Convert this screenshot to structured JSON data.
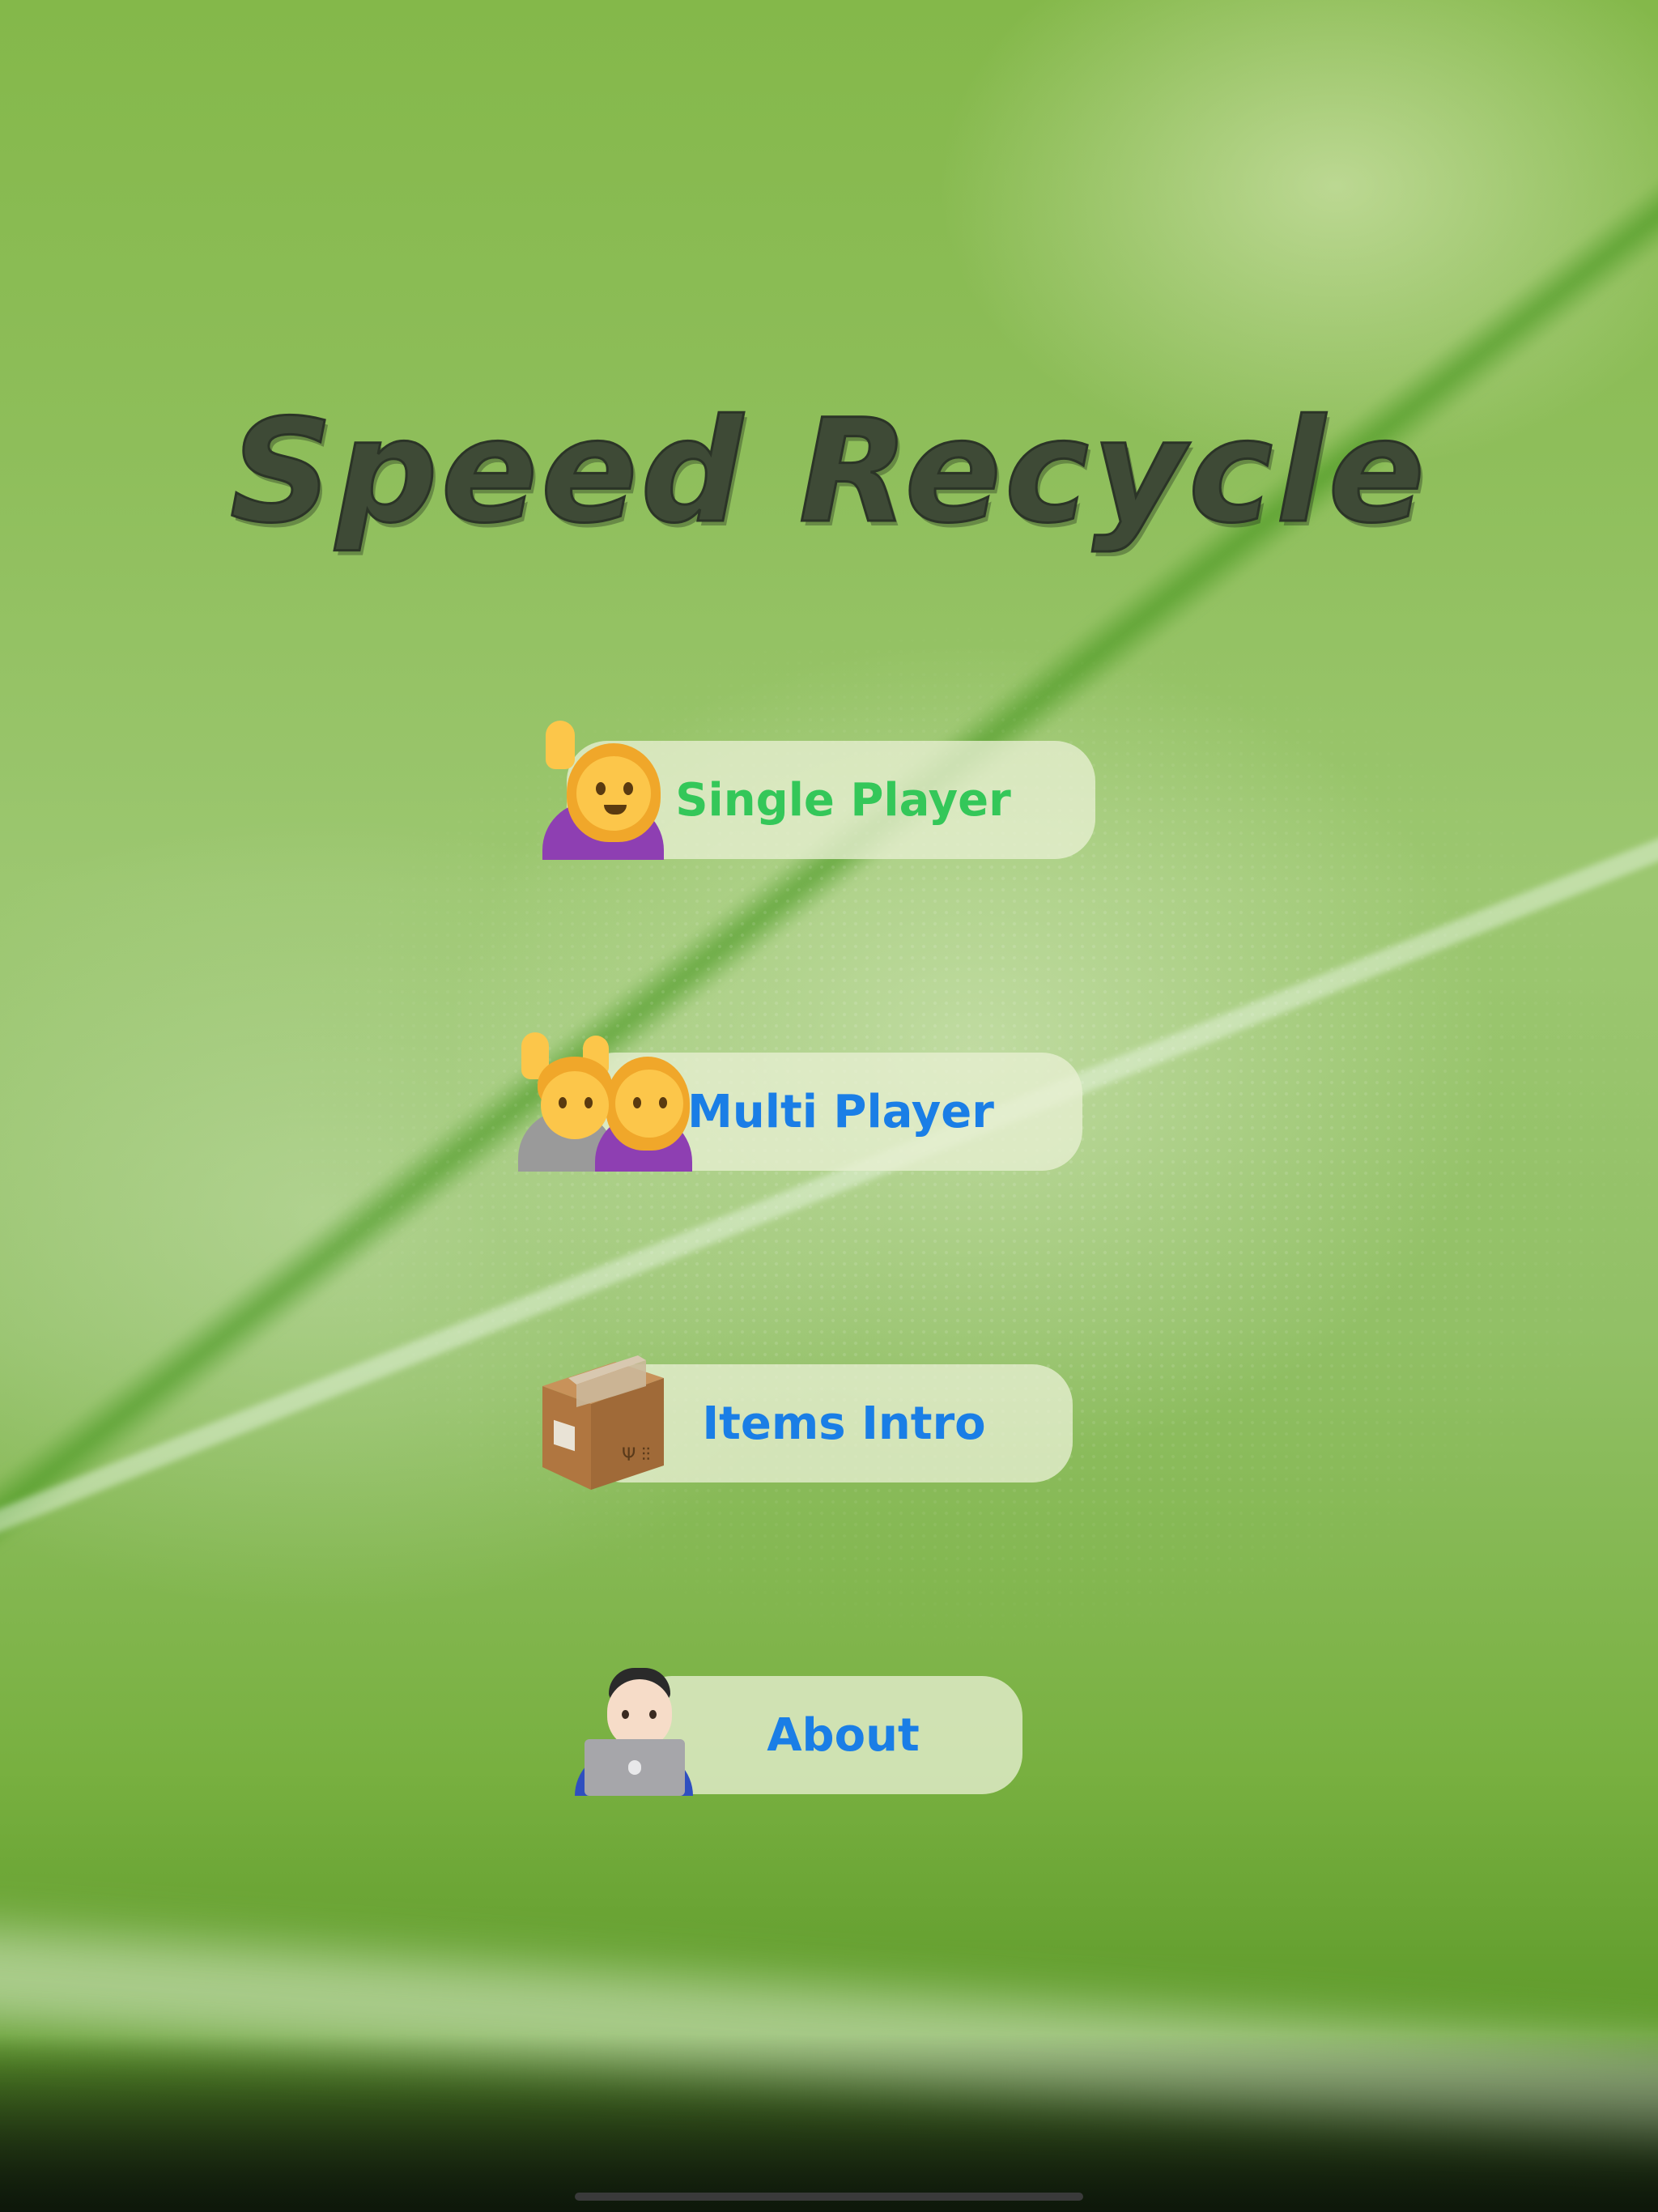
{
  "app": {
    "title": "Speed Recycle"
  },
  "menu": {
    "single_player": {
      "label": "Single Player",
      "icon": "woman-raising-hand-icon",
      "color": "#34c759"
    },
    "multi_player": {
      "label": "Multi Player",
      "icon": "two-people-raising-hands-icon",
      "color": "#1a7ee6"
    },
    "items_intro": {
      "label": "Items Intro",
      "icon": "package-icon",
      "color": "#1a7ee6"
    },
    "about": {
      "label": "About",
      "icon": "technologist-laptop-icon",
      "color": "#1a7ee6"
    }
  },
  "colors": {
    "title": "#3e4a36",
    "button_bg": "#e8f0d2"
  }
}
